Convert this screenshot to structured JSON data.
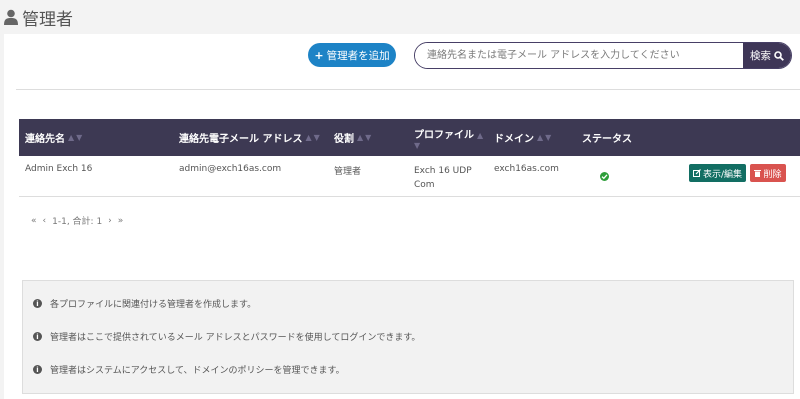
{
  "header": {
    "title": "管理者"
  },
  "toolbar": {
    "add_label": "管理者を追加",
    "search_placeholder": "連絡先名または電子メール アドレスを入力してください",
    "search_label": "検索"
  },
  "table": {
    "columns": [
      "連絡先名",
      "連絡先電子メール アドレス",
      "役割",
      "プロファイル",
      "ドメイン",
      "ステータス"
    ],
    "rows": [
      {
        "name": "Admin Exch 16",
        "email": "admin@exch16as.com",
        "role": "管理者",
        "profile_line1": "Exch 16 UDP",
        "profile_line2": "Com",
        "domain": "exch16as.com",
        "edit_label": "表示/編集",
        "delete_label": "削除"
      }
    ]
  },
  "pagination": {
    "first": "«",
    "prev": "‹",
    "summary": "1-1, 合計: 1",
    "next": "›",
    "last": "»"
  },
  "info": {
    "lines": [
      "各プロファイルに関連付ける管理者を作成します。",
      "管理者はここで提供されているメール アドレスとパスワードを使用してログインできます。",
      "管理者はシステムにアクセスして、ドメインのポリシーを管理できます。"
    ]
  },
  "colors": {
    "header_bg": "#3d3953",
    "primary": "#1d83c6",
    "edit": "#126e63",
    "delete": "#d9534f",
    "ok": "#2e9e3a"
  },
  "icons": {
    "header": "user-icon",
    "add": "plus-icon",
    "search": "search-icon",
    "edit": "edit-icon",
    "delete": "trash-icon",
    "status": "check-circle-icon",
    "info": "info-circle-icon"
  }
}
